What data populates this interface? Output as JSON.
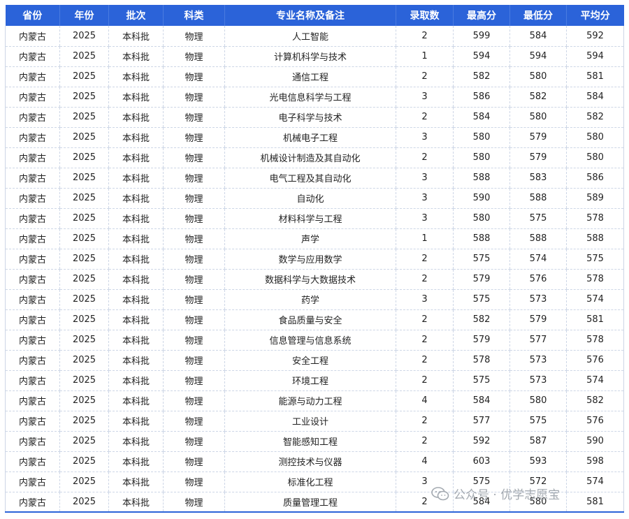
{
  "columns": [
    "省份",
    "年份",
    "批次",
    "科类",
    "专业名称及备注",
    "录取数",
    "最高分",
    "最低分",
    "平均分"
  ],
  "rows": [
    [
      "内蒙古",
      "2025",
      "本科批",
      "物理",
      "人工智能",
      "2",
      "599",
      "584",
      "592"
    ],
    [
      "内蒙古",
      "2025",
      "本科批",
      "物理",
      "计算机科学与技术",
      "1",
      "594",
      "594",
      "594"
    ],
    [
      "内蒙古",
      "2025",
      "本科批",
      "物理",
      "通信工程",
      "2",
      "582",
      "580",
      "581"
    ],
    [
      "内蒙古",
      "2025",
      "本科批",
      "物理",
      "光电信息科学与工程",
      "3",
      "586",
      "582",
      "584"
    ],
    [
      "内蒙古",
      "2025",
      "本科批",
      "物理",
      "电子科学与技术",
      "2",
      "584",
      "580",
      "582"
    ],
    [
      "内蒙古",
      "2025",
      "本科批",
      "物理",
      "机械电子工程",
      "3",
      "580",
      "579",
      "580"
    ],
    [
      "内蒙古",
      "2025",
      "本科批",
      "物理",
      "机械设计制造及其自动化",
      "2",
      "580",
      "579",
      "580"
    ],
    [
      "内蒙古",
      "2025",
      "本科批",
      "物理",
      "电气工程及其自动化",
      "3",
      "588",
      "583",
      "586"
    ],
    [
      "内蒙古",
      "2025",
      "本科批",
      "物理",
      "自动化",
      "3",
      "590",
      "588",
      "589"
    ],
    [
      "内蒙古",
      "2025",
      "本科批",
      "物理",
      "材料科学与工程",
      "3",
      "580",
      "575",
      "578"
    ],
    [
      "内蒙古",
      "2025",
      "本科批",
      "物理",
      "声学",
      "1",
      "588",
      "588",
      "588"
    ],
    [
      "内蒙古",
      "2025",
      "本科批",
      "物理",
      "数学与应用数学",
      "2",
      "575",
      "574",
      "575"
    ],
    [
      "内蒙古",
      "2025",
      "本科批",
      "物理",
      "数据科学与大数据技术",
      "2",
      "579",
      "576",
      "578"
    ],
    [
      "内蒙古",
      "2025",
      "本科批",
      "物理",
      "药学",
      "3",
      "575",
      "573",
      "574"
    ],
    [
      "内蒙古",
      "2025",
      "本科批",
      "物理",
      "食品质量与安全",
      "2",
      "582",
      "579",
      "581"
    ],
    [
      "内蒙古",
      "2025",
      "本科批",
      "物理",
      "信息管理与信息系统",
      "2",
      "579",
      "577",
      "578"
    ],
    [
      "内蒙古",
      "2025",
      "本科批",
      "物理",
      "安全工程",
      "2",
      "578",
      "573",
      "576"
    ],
    [
      "内蒙古",
      "2025",
      "本科批",
      "物理",
      "环境工程",
      "2",
      "575",
      "573",
      "574"
    ],
    [
      "内蒙古",
      "2025",
      "本科批",
      "物理",
      "能源与动力工程",
      "4",
      "584",
      "580",
      "582"
    ],
    [
      "内蒙古",
      "2025",
      "本科批",
      "物理",
      "工业设计",
      "2",
      "577",
      "575",
      "576"
    ],
    [
      "内蒙古",
      "2025",
      "本科批",
      "物理",
      "智能感知工程",
      "2",
      "592",
      "587",
      "590"
    ],
    [
      "内蒙古",
      "2025",
      "本科批",
      "物理",
      "测控技术与仪器",
      "4",
      "603",
      "593",
      "598"
    ],
    [
      "内蒙古",
      "2025",
      "本科批",
      "物理",
      "标准化工程",
      "3",
      "575",
      "572",
      "574"
    ],
    [
      "内蒙古",
      "2025",
      "本科批",
      "物理",
      "质量管理工程",
      "2",
      "584",
      "580",
      "581"
    ]
  ],
  "watermark": {
    "text": "公众号 · 优学志愿宝",
    "icon": "wechat-icon"
  },
  "colors": {
    "header_bg": "#2b63d9",
    "header_text": "#ffffff",
    "grid_line": "#cdd6e6",
    "watermark": "#9aa0a8"
  }
}
